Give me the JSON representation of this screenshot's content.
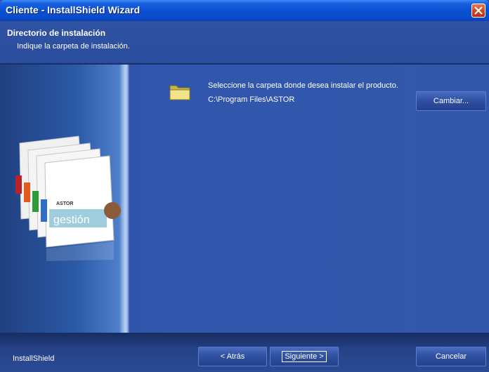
{
  "window": {
    "title": "Cliente - InstallShield Wizard"
  },
  "header": {
    "title": "Directorio de instalación",
    "subtitle": "Indique la carpeta de instalación."
  },
  "main": {
    "instruction": "Seleccione la carpeta donde desea instalar el producto.",
    "install_path": "C:\\Program Files\\ASTOR",
    "change_button": "Cambiar...",
    "product_brand": "ASTOR",
    "product_name": "gestión"
  },
  "footer": {
    "brand": "InstallShield",
    "back_button": "< Atrás",
    "next_button": "Siguiente >",
    "cancel_button": "Cancelar"
  },
  "icons": {
    "folder": "folder-icon",
    "close": "close-icon"
  },
  "colors": {
    "titlebar": "#0a4fd4",
    "background": "#2f52a6",
    "close": "#d2411b"
  }
}
